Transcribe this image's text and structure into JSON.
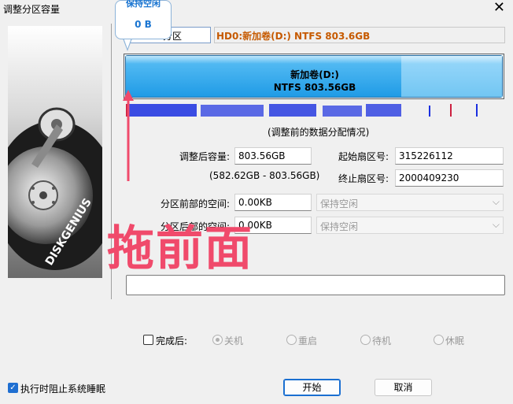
{
  "window": {
    "title": "调整分区容量",
    "close": "✕"
  },
  "tooltip": {
    "line1": "保持空闲",
    "line2": "0 B"
  },
  "partition_field": "分区",
  "disk_info": "HD0:新加卷(D:) NTFS 803.6GB",
  "bar": {
    "name": "新加卷(D:)",
    "fs": "NTFS 803.56GB"
  },
  "distribution_caption": "(调整前的数据分配情况)",
  "size": {
    "label": "调整后容量:",
    "value": "803.56GB",
    "range": "(582.62GB - 803.56GB)"
  },
  "start_sector": {
    "label": "起始扇区号:",
    "value": "315226112"
  },
  "end_sector": {
    "label": "终止扇区号:",
    "value": "2000409230"
  },
  "before": {
    "label": "分区前部的空间:",
    "value": "0.00KB",
    "action": "保持空闲"
  },
  "after": {
    "label": "分区后部的空间:",
    "value": "0.00KB",
    "action": "保持空闲"
  },
  "overlay": "拖前面",
  "after_done": {
    "label": "完成后:",
    "options": [
      "关机",
      "重启",
      "待机",
      "休眠"
    ]
  },
  "prevent_sleep": "执行时阻止系统睡眠",
  "buttons": {
    "start": "开始",
    "cancel": "取消"
  },
  "brand": "DISKGENIUS",
  "colors": {
    "bar": "#1f9be6",
    "overlay": "#f04a6b",
    "disk_info": "#c65a00",
    "tooltip": "#1a75d1"
  }
}
